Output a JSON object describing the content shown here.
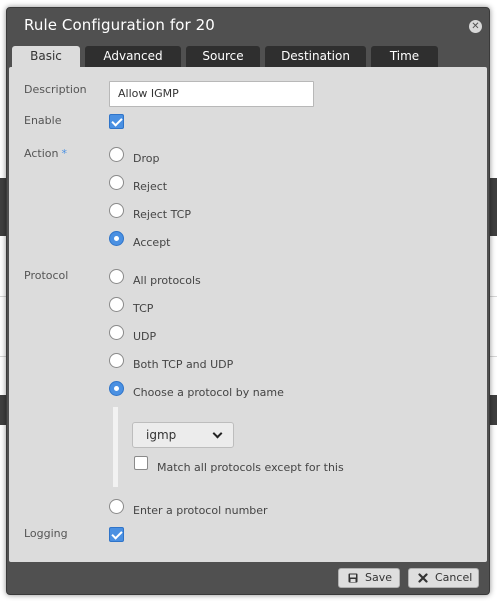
{
  "dialog": {
    "title": "Rule Configuration for 20",
    "close_icon": "close-icon"
  },
  "tabs": [
    {
      "label": "Basic",
      "active": true
    },
    {
      "label": "Advanced",
      "active": false
    },
    {
      "label": "Source",
      "active": false
    },
    {
      "label": "Destination",
      "active": false
    },
    {
      "label": "Time",
      "active": false
    }
  ],
  "form": {
    "description": {
      "label": "Description",
      "value": "Allow IGMP"
    },
    "enable": {
      "label": "Enable",
      "checked": true
    },
    "action": {
      "label": "Action",
      "required_mark": "*",
      "options": [
        "Drop",
        "Reject",
        "Reject TCP",
        "Accept"
      ],
      "selected": "Accept"
    },
    "protocol": {
      "label": "Protocol",
      "options": [
        "All protocols",
        "TCP",
        "UDP",
        "Both TCP and UDP",
        "Choose a protocol by name",
        "Enter a protocol number"
      ],
      "selected": "Choose a protocol by name",
      "protocol_name": "igmp",
      "match_except_label": "Match all protocols except for this",
      "match_except_checked": false
    },
    "logging": {
      "label": "Logging",
      "checked": true
    }
  },
  "footer": {
    "save_label": "Save",
    "cancel_label": "Cancel",
    "save_icon": "floppy-disk-icon",
    "cancel_icon": "x-icon"
  },
  "colors": {
    "accent": "#4a90e2",
    "dialog_frame": "#505050",
    "panel": "#dcdcdc",
    "tab_inactive": "#2f2f2f"
  }
}
